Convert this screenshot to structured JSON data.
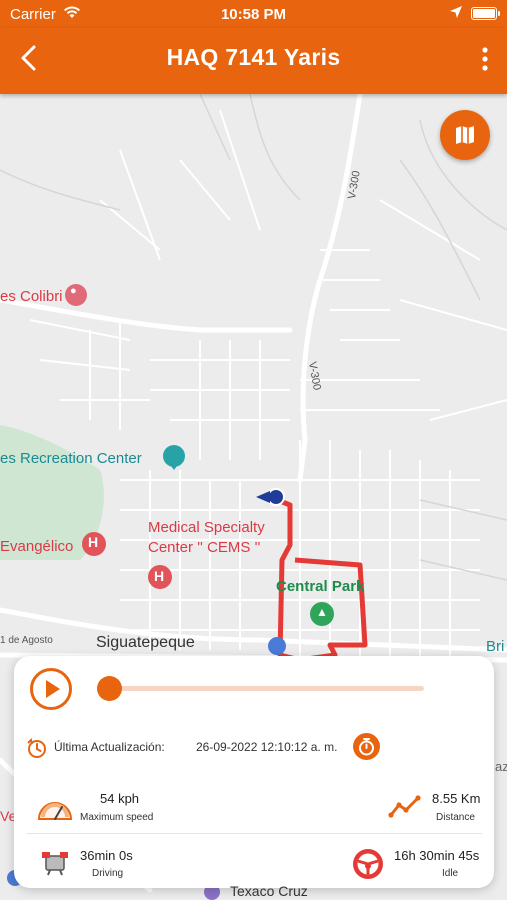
{
  "status_bar": {
    "carrier": "Carrier",
    "time": "10:58 PM"
  },
  "nav": {
    "title": "HAQ 7141 Yaris"
  },
  "map": {
    "labels": {
      "hotel": "es Colibri",
      "recreation": "es Recreation Center",
      "medical_1": "Medical Specialty",
      "medical_2": "Center '' CEMS ''",
      "evangelico": "Evangélico",
      "central_park": "Central Park",
      "siguatepeque": "Siguatepeque",
      "agosto": "1 de Agosto",
      "bri": "Bri",
      "texaco": "Texaco Cruz",
      "road_v300_top": "V-300",
      "road_v300_mid": "V-300",
      "ve": "Ve",
      "az": "az"
    }
  },
  "panel": {
    "playback": {
      "progress": 0.03
    },
    "last_update_label": "Última Actualización:",
    "last_update_value": "26-09-2022 12:10:12 a. m.",
    "stats": {
      "max_speed": {
        "value": "54 kph",
        "label": "Maximum speed"
      },
      "distance": {
        "value": "8.55 Km",
        "label": "Distance"
      },
      "driving": {
        "value": "36min 0s",
        "label": "Driving"
      },
      "idle": {
        "value": "16h 30min 45s",
        "label": "Idle"
      }
    }
  },
  "colors": {
    "brand": "#e8640f",
    "route": "#e53935",
    "map_bg": "#ececec"
  },
  "icons": {
    "back": "chevron-left-icon",
    "more": "more-vertical-icon",
    "map_toggle": "map-icon",
    "play": "play-icon",
    "timer": "stopwatch-icon",
    "update": "history-icon",
    "speed": "speedometer-icon",
    "distance": "route-trend-icon",
    "driving": "engine-icon",
    "idle": "steering-wheel-icon"
  }
}
